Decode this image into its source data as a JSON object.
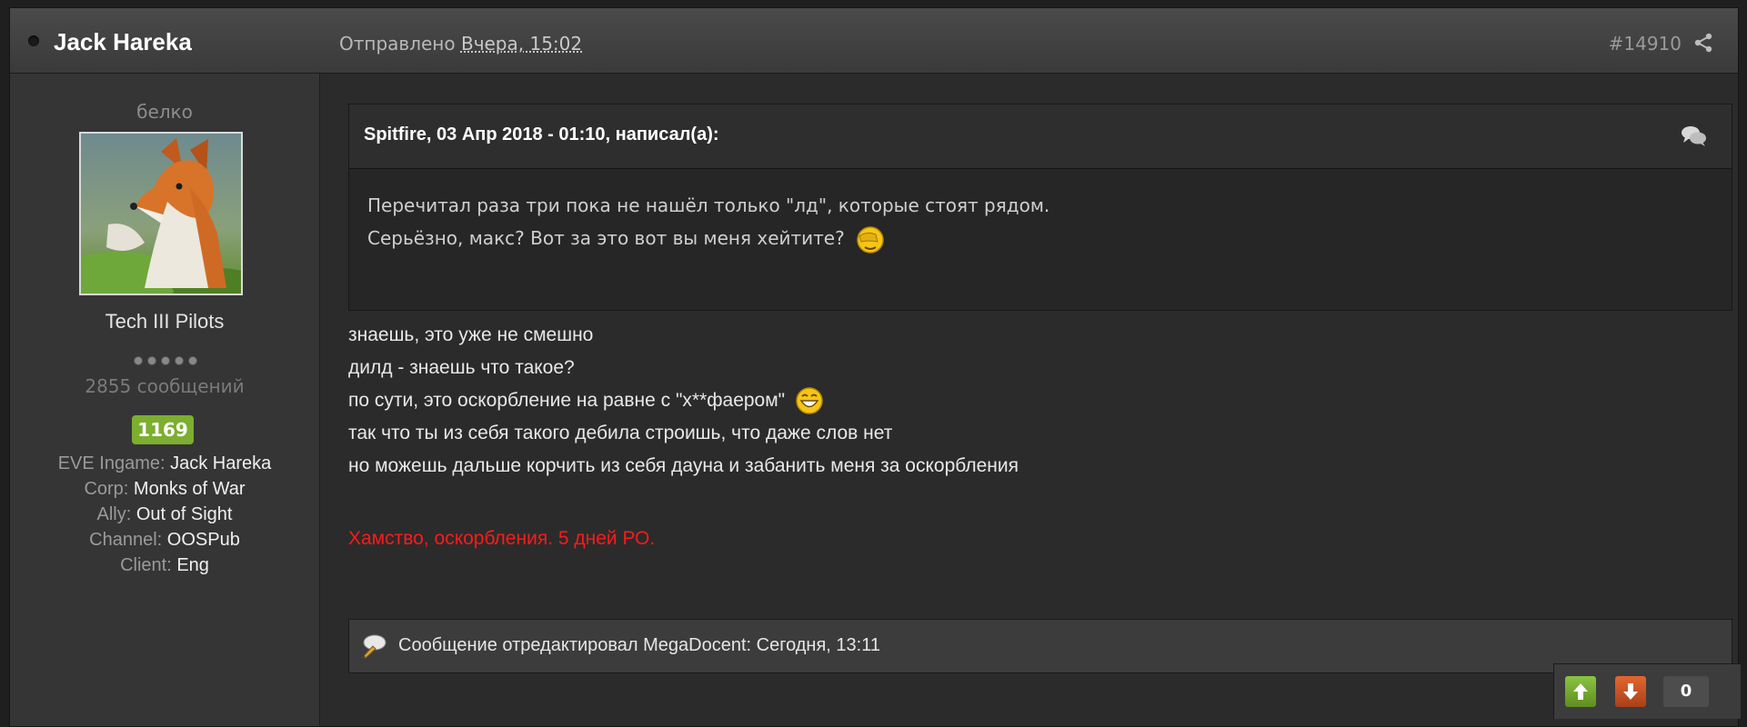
{
  "header": {
    "author": "Jack Hareka",
    "posted_prefix": "Отправлено",
    "posted_date": "Вчера, 15:02",
    "post_number": "#14910"
  },
  "author_panel": {
    "rank_title": "белко",
    "group": "Tech III Pilots",
    "pips": 5,
    "post_count": "2855 сообщений",
    "reputation": "1169",
    "fields": [
      {
        "key": "EVE Ingame:",
        "value": "Jack Hareka"
      },
      {
        "key": "Corp:",
        "value": "Monks of War"
      },
      {
        "key": "Ally:",
        "value": "Out of Sight"
      },
      {
        "key": "Channel:",
        "value": "OOSPub"
      },
      {
        "key": "Client:",
        "value": "Eng"
      }
    ]
  },
  "quote": {
    "citation": "Spitfire, 03 Апр 2018 - 01:10, написал(а):",
    "line1": "Перечитал раза три пока не нашёл только \"лд\", которые стоят рядом.",
    "line2": "Серьёзно, макс? Вот за это вот вы меня хейтите?"
  },
  "body": {
    "line1": "знаешь, это уже не смешно",
    "line2": "дилд - знаешь что такое?",
    "line3": "по сути, это оскорбление на равне с \"х**фаером\"",
    "line4": "так что ты из себя такого дебила строишь, что даже слов нет",
    "line5": "но можешь дальше корчить из себя дауна и забанить меня за оскорбления"
  },
  "moderator_note": "Хамство, оскорбления. 5 дней РО.",
  "edit_note": "Сообщение отредактировал MegaDocent: Сегодня, 13:11",
  "reputation_controls": {
    "value": "0"
  },
  "colors": {
    "moderator_note": "#ff1a1a",
    "rep_badge": "#7cae2f",
    "rep_up": "#6ea32c",
    "rep_down": "#c9501f"
  }
}
